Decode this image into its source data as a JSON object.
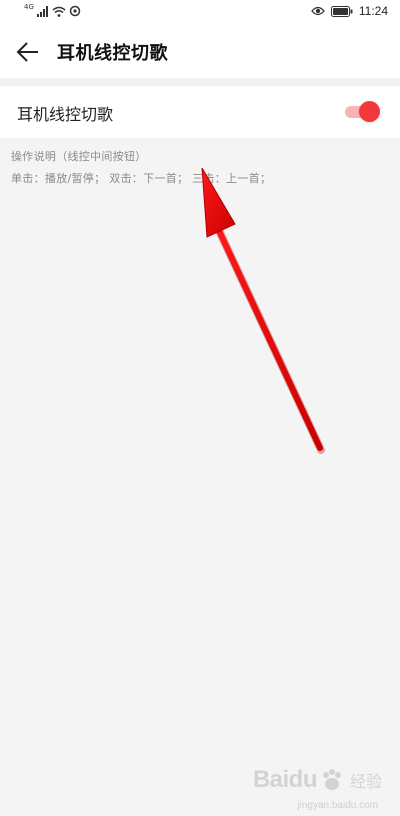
{
  "status_bar": {
    "network_label": "4G",
    "time": "11:24"
  },
  "header": {
    "back_icon": "arrow-left-icon",
    "title": "耳机线控切歌"
  },
  "setting": {
    "label": "耳机线控切歌",
    "toggle_on": true
  },
  "description": {
    "title": "操作说明（线控中间按钮）",
    "body": "单击：播放/暂停； 双击：下一首； 三击：上一首；"
  },
  "watermark": {
    "brand": "Baidu",
    "sub": "经验",
    "url": "jingyan.baidu.com"
  },
  "colors": {
    "accent": "#f1383b",
    "track": "#f8b4b4",
    "annotation_arrow": "#e00000",
    "background": "#f4f4f4"
  }
}
